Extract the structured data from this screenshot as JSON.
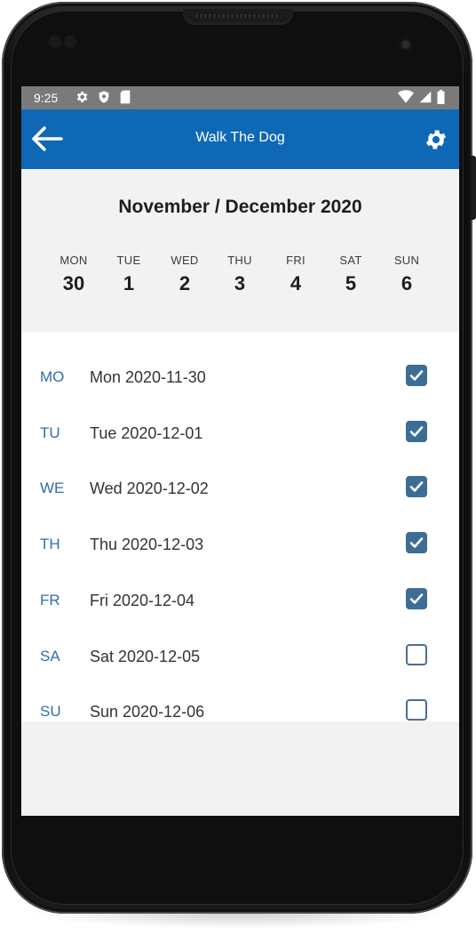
{
  "status_bar": {
    "time": "9:25",
    "left_icons": [
      "gear-icon",
      "shield-icon",
      "sd-card-icon"
    ],
    "right_icons": [
      "wifi-icon",
      "signal-icon",
      "battery-icon"
    ]
  },
  "app_bar": {
    "title": "Walk The Dog",
    "back_icon": "arrow-left-icon",
    "settings_icon": "gear-icon",
    "color": "#0f68b5"
  },
  "week": {
    "title": "November / December 2020",
    "days": [
      {
        "name": "MON",
        "num": "30"
      },
      {
        "name": "TUE",
        "num": "1"
      },
      {
        "name": "WED",
        "num": "2"
      },
      {
        "name": "THU",
        "num": "3"
      },
      {
        "name": "FRI",
        "num": "4"
      },
      {
        "name": "SAT",
        "num": "5"
      },
      {
        "name": "SUN",
        "num": "6"
      }
    ]
  },
  "entries": [
    {
      "abbr": "MO",
      "label": "Mon 2020-11-30",
      "checked": true
    },
    {
      "abbr": "TU",
      "label": "Tue 2020-12-01",
      "checked": true
    },
    {
      "abbr": "WE",
      "label": "Wed 2020-12-02",
      "checked": true
    },
    {
      "abbr": "TH",
      "label": "Thu 2020-12-03",
      "checked": true
    },
    {
      "abbr": "FR",
      "label": "Fri 2020-12-04",
      "checked": true
    },
    {
      "abbr": "SA",
      "label": "Sat 2020-12-05",
      "checked": false
    },
    {
      "abbr": "SU",
      "label": "Sun 2020-12-06",
      "checked": false
    }
  ],
  "colors": {
    "accent": "#0f68b5",
    "checkbox": "#3c6d95",
    "abbr_text": "#2e6ead"
  }
}
